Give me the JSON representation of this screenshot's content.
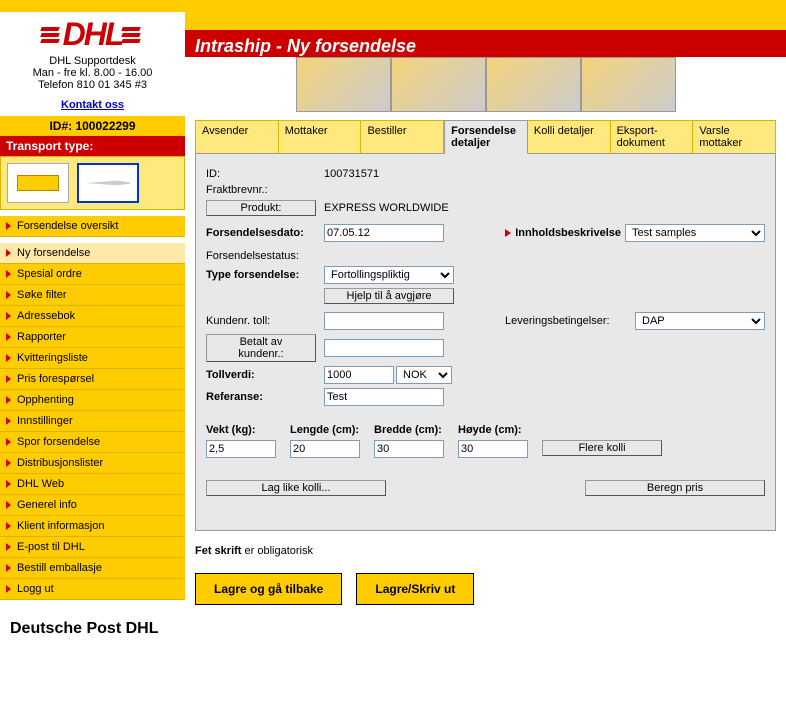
{
  "support": {
    "line1": "DHL Supportdesk",
    "line2": "Man - fre kl. 8.00 - 16.00",
    "line3": "Telefon 810 01 345 #3",
    "link": "Kontakt oss"
  },
  "page_title": "Intraship - Ny forsendelse",
  "id_label": "ID#: 100022299",
  "transport_header": "Transport type:",
  "nav_top": "Forsendelse oversikt",
  "nav": [
    "Ny forsendelse",
    "Spesial ordre",
    "Søke filter",
    "Adressebok",
    "Rapporter",
    "Kvitteringsliste",
    "Pris forespørsel",
    "Opphenting",
    "Innstillinger",
    "Spor forsendelse",
    "Distribusjonslister",
    "DHL Web",
    "Generel info",
    "Klient informasjon",
    "E-post til DHL",
    "Bestill emballasje",
    "Logg ut"
  ],
  "footer_logo": "Deutsche Post DHL",
  "tabs": [
    "Avsender",
    "Mottaker",
    "Bestiller",
    "Forsendelse detaljer",
    "Kolli detaljer",
    "Eksport-dokument",
    "Varsle mottaker"
  ],
  "active_tab": 3,
  "form": {
    "id_label": "ID:",
    "id_value": "100731571",
    "fraktbrev_label": "Fraktbrevnr.:",
    "produkt_btn": "Produkt:",
    "produkt_value": "EXPRESS WORLDWIDE",
    "date_label": "Forsendelsesdato:",
    "date_value": "07.05.12",
    "innhold_label": "Innholdsbeskrivelse",
    "innhold_value": "Test samples",
    "status_label": "Forsendelsestatus:",
    "type_label": "Type forsendelse:",
    "type_value": "Fortollingspliktig",
    "type_help_btn": "Hjelp til å avgjøre",
    "kundenr_label": "Kundenr. toll:",
    "betalt_btn": "Betalt av kundenr.:",
    "lever_label": "Leveringsbetingelser:",
    "lever_value": "DAP",
    "tollverdi_label": "Tollverdi:",
    "tollverdi_value": "1000",
    "tollverdi_currency": "NOK",
    "referanse_label": "Referanse:",
    "referanse_value": "Test",
    "vekt_label": "Vekt (kg):",
    "vekt_value": "2,5",
    "lengde_label": "Lengde (cm):",
    "lengde_value": "20",
    "bredde_label": "Bredde (cm):",
    "bredde_value": "30",
    "hoyde_label": "Høyde (cm):",
    "hoyde_value": "30",
    "flere_kolli_btn": "Flere kolli",
    "like_kolli_btn": "Lag like kolli...",
    "beregn_btn": "Beregn pris",
    "note_bold": "Fet skrift",
    "note_rest": " er obligatorisk",
    "btn_back": "Lagre og gå tilbake",
    "btn_print": "Lagre/Skriv ut"
  }
}
